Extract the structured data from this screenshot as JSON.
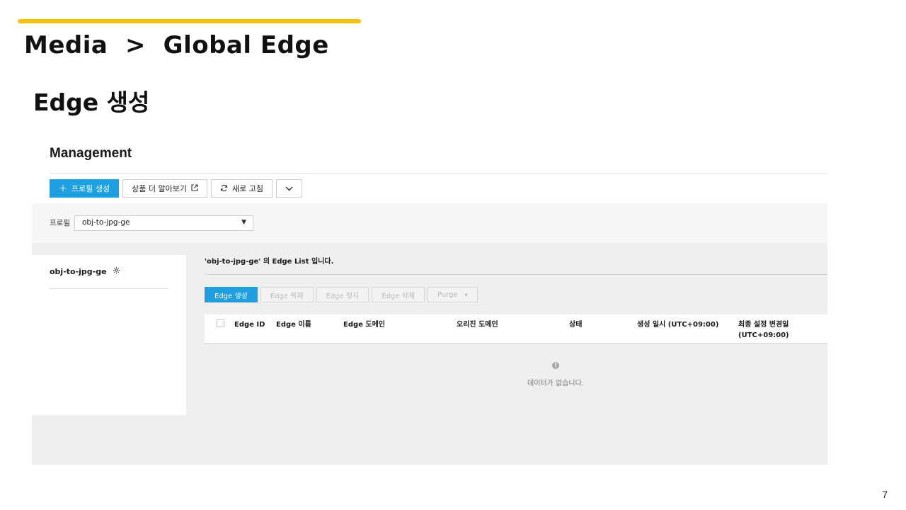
{
  "slide": {
    "title": "Media  >  Global Edge",
    "subtitle": "Edge 생성",
    "page_number": "7",
    "accent_color": "#f4c20d"
  },
  "management": {
    "title": "Management",
    "toolbar": {
      "create_profile": "프로필 생성",
      "learn_more": "상품 더 알아보기",
      "refresh": "새로 고침",
      "icons": [
        "plus-icon",
        "external-link-icon",
        "refresh-icon",
        "chevron-down-icon"
      ]
    },
    "profile": {
      "label": "프로필",
      "selected": "obj-to-jpg-ge"
    },
    "sidebar": {
      "items": [
        {
          "label": "obj-to-jpg-ge",
          "icon": "gear-icon"
        }
      ]
    },
    "edge_list": {
      "caption": "'obj-to-jpg-ge' 의 Edge List 입니다.",
      "actions": {
        "create": "Edge 생성",
        "copy": "Edge 복제",
        "stop": "Edge 정지",
        "delete": "Edge 삭제",
        "purge": "Purge"
      },
      "columns": {
        "edge_id": "Edge ID",
        "edge_name": "Edge 이름",
        "edge_domain": "Edge 도메인",
        "origin_domain": "오리진 도메인",
        "status": "상태",
        "created_at": "생성 일시 (UTC+09:00)",
        "last_modified_line1": "최종 설정 변경일",
        "last_modified_line2": "(UTC+09:00)"
      },
      "empty_text": "데이터가 없습니다."
    },
    "primary_color": "#1e9fe0"
  }
}
